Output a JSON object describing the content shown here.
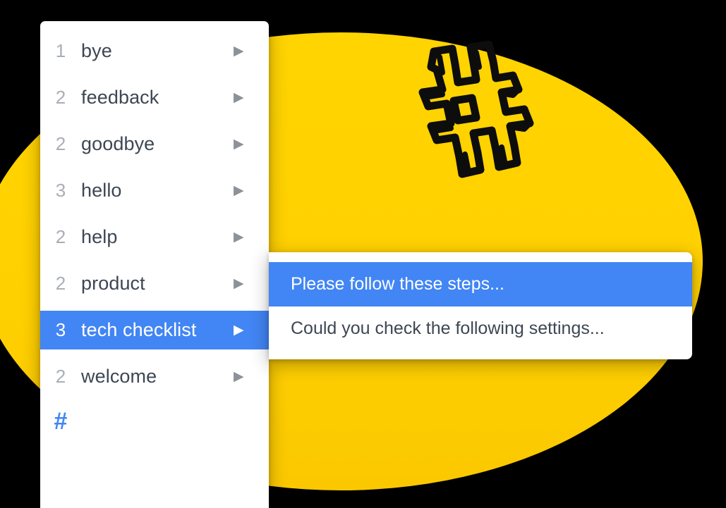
{
  "theme": {
    "accent_blue": "#4285F4",
    "brand_yellow": "#FFD400",
    "text_dark": "#3d4754",
    "count_grey": "#a9aeb5"
  },
  "decoration": {
    "blob_name": "yellow-blob",
    "illustration": "hashtag-illustration",
    "hashtag_symbol": "#"
  },
  "shortcut_list": {
    "items": [
      {
        "count": "1",
        "label": "bye",
        "caret": "▶",
        "selected": false
      },
      {
        "count": "2",
        "label": "feedback",
        "caret": "▶",
        "selected": false
      },
      {
        "count": "2",
        "label": "goodbye",
        "caret": "▶",
        "selected": false
      },
      {
        "count": "3",
        "label": "hello",
        "caret": "▶",
        "selected": false
      },
      {
        "count": "2",
        "label": "help",
        "caret": "▶",
        "selected": false
      },
      {
        "count": "2",
        "label": "product",
        "caret": "▶",
        "selected": false
      },
      {
        "count": "3",
        "label": "tech checklist",
        "caret": "▶",
        "selected": true
      },
      {
        "count": "2",
        "label": "welcome",
        "caret": "▶",
        "selected": false
      }
    ],
    "footer_glyph": "#"
  },
  "submenu": {
    "items": [
      {
        "label": "Please follow these steps...",
        "active": true
      },
      {
        "label": "Could you check the following settings...",
        "active": false
      }
    ]
  }
}
